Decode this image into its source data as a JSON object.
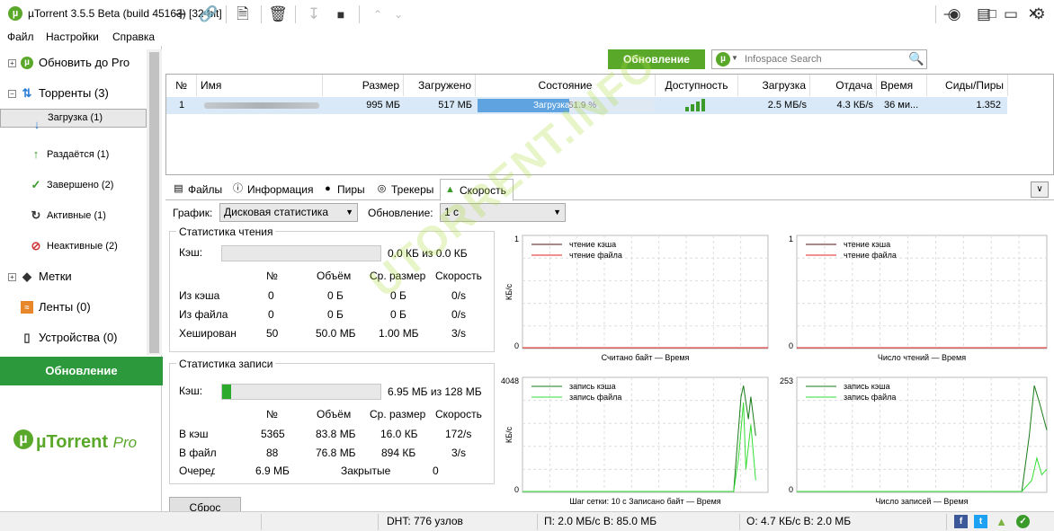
{
  "window": {
    "title": "µTorrent 3.5.5 Beta (build 45163) [32-bit]",
    "logo_letter": "µ"
  },
  "menu": [
    "Файл",
    "Настройки",
    "Справка"
  ],
  "sidebar": {
    "items": [
      {
        "label": "Обновить до Pro",
        "icon": "utorrent-logo-icon"
      },
      {
        "label": "Торренты (3)",
        "icon": "torrents-icon"
      },
      {
        "label": "Загрузка (1)",
        "icon": "download-arrow-icon"
      },
      {
        "label": "Раздаётся (1)",
        "icon": "upload-arrow-icon"
      },
      {
        "label": "Завершено (2)",
        "icon": "checkmark-icon"
      },
      {
        "label": "Активные (1)",
        "icon": "refresh-icon"
      },
      {
        "label": "Неактивные (2)",
        "icon": "inactive-icon"
      },
      {
        "label": "Метки",
        "icon": "tag-icon"
      },
      {
        "label": "Ленты (0)",
        "icon": "rss-icon"
      },
      {
        "label": "Устройства (0)",
        "icon": "device-icon"
      }
    ],
    "update_button": "Обновление",
    "pro_logo": "µTorrent",
    "pro_suffix": "Pro"
  },
  "toolbar": {
    "update_button": "Обновление",
    "search_placeholder": "Infospace Search"
  },
  "list": {
    "headers": [
      "№",
      "Имя",
      "Размер",
      "Загружено",
      "Состояние",
      "Доступность",
      "Загрузка",
      "Отдача",
      "Время",
      "Сиды/Пиры"
    ],
    "row": {
      "num": "1",
      "size": "995 МБ",
      "downloaded": "517 МБ",
      "status": "Загрузка",
      "percent": "51.9 %",
      "progress": 0.519,
      "down": "2.5 МБ/s",
      "up": "4.3 КБ/s",
      "time": "36 ми...",
      "seeds": "1.352"
    }
  },
  "tabs": [
    "Файлы",
    "Информация",
    "Пиры",
    "Трекеры",
    "Скорость"
  ],
  "graph_controls": {
    "graph_label": "График:",
    "graph_value": "Дисковая статистика",
    "update_label": "Обновление:",
    "update_value": "1 с"
  },
  "read_stats": {
    "title": "Статистика чтения",
    "cache_label": "Кэш:",
    "cache_value": "0.0 КБ из 0.0 КБ",
    "cache_fill": 0,
    "headers": [
      "№",
      "Объём",
      "Ср. размер",
      "Скорость"
    ],
    "rows": [
      {
        "label": "Из кэша",
        "n": "0",
        "vol": "0 Б",
        "avg": "0 Б",
        "speed": "0/s"
      },
      {
        "label": "Из файла",
        "n": "0",
        "vol": "0 Б",
        "avg": "0 Б",
        "speed": "0/s"
      },
      {
        "label": "Хеширован",
        "n": "50",
        "vol": "50.0 МБ",
        "avg": "1.00 МБ",
        "speed": "3/s"
      }
    ]
  },
  "write_stats": {
    "title": "Статистика записи",
    "cache_label": "Кэш:",
    "cache_value": "6.95 МБ из 128 МБ",
    "cache_fill": 0.054,
    "headers": [
      "№",
      "Объём",
      "Ср. размер",
      "Скорость"
    ],
    "rows": [
      {
        "label": "В кэш",
        "n": "5365",
        "vol": "83.8 МБ",
        "avg": "16.0 КБ",
        "speed": "172/s"
      },
      {
        "label": "В файл",
        "n": "88",
        "vol": "76.8 МБ",
        "avg": "894 КБ",
        "speed": "3/s"
      }
    ],
    "queue_label": "Очеред",
    "queue_value": "6.9 МБ",
    "closed_label": "Закрытые",
    "closed_value": "0"
  },
  "reset_button": "Сброс",
  "graphs": [
    {
      "ymax": "1",
      "ymin": "0",
      "ylabel": "КБ/с",
      "legend": [
        "чтение кэша",
        "чтение файла"
      ],
      "colors": [
        "#5a1010",
        "#e02020"
      ],
      "xlabel": "Считано байт — Время"
    },
    {
      "ymax": "1",
      "ymin": "0",
      "ylabel": "",
      "legend": [
        "чтение кэша",
        "чтение файла"
      ],
      "colors": [
        "#5a1010",
        "#e02020"
      ],
      "xlabel": "Число чтений — Время"
    },
    {
      "ymax": "4048",
      "ymin": "0",
      "ylabel": "КБ/с",
      "legend": [
        "запись кэша",
        "запись файла"
      ],
      "colors": [
        "#1a7a1a",
        "#33dd33"
      ],
      "xlabel": "Шаг сетки: 10 с    Записано байт — Время"
    },
    {
      "ymax": "253",
      "ymin": "0",
      "ylabel": "",
      "legend": [
        "запись кэша",
        "запись файла"
      ],
      "colors": [
        "#1a7a1a",
        "#33dd33"
      ],
      "xlabel": "Число записей — Время"
    }
  ],
  "status": {
    "dht": "DHT: 776 узлов",
    "down": "П: 2.0 МБ/с В: 85.0 МБ",
    "up": "О: 4.7 КБ/с В: 2.0 МБ"
  },
  "watermark": "UTORRENT.INFO"
}
